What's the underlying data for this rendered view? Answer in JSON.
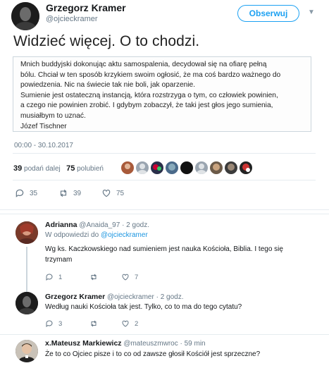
{
  "tweet": {
    "author": {
      "name": "Grzegorz Kramer",
      "handle": "@ojcieckramer"
    },
    "follow_label": "Obserwuj",
    "text": "Widzieć więcej. O to chodzi.",
    "quote_lines": [
      "Mnich buddyjski dokonując aktu samospalenia, decydował się na ofiarę pełną",
      "bólu. Chciał w ten sposób krzykiem swoim ogłosić, że ma coś bardzo ważnego do",
      "powiedzenia. Nic na świecie tak nie boli, jak oparzenie.",
      "Sumienie jest ostateczną instancją, która rozstrzyga o tym, co człowiek powinien,",
      "a czego nie powinien zrobić. I gdybym zobaczył, że taki jest głos jego sumienia,",
      "musiałbym to uznać.",
      "Józef Tischner"
    ],
    "timestamp": "00:00 - 30.10.2017",
    "retweets_count": "39",
    "retweets_label": "podań dalej",
    "likes_count": "75",
    "likes_label": "polubień",
    "actions": {
      "replies": "35",
      "retweets": "39",
      "likes": "75"
    }
  },
  "replies": [
    {
      "name": "Adrianna",
      "handle": "@Anaida_97",
      "time": "· 2 godz.",
      "reply_prefix": "W odpowiedzi do",
      "reply_to": "@ojcieckramer",
      "text_lines": [
        "Wg ks. Kaczkowskiego nad sumieniem jest nauka Kościoła, Biblia. I tego się",
        "trzymam"
      ],
      "actions": {
        "replies": "1",
        "retweets": "",
        "likes": "7"
      }
    },
    {
      "name": "Grzegorz Kramer",
      "handle": "@ojcieckramer",
      "time": "· 2 godz.",
      "text_lines": [
        "Według nauki Kościoła tak jest. Tylko, co to ma do tego cytatu?"
      ],
      "actions": {
        "replies": "3",
        "retweets": "",
        "likes": "2"
      }
    },
    {
      "name": "x.Mateusz Markiewicz",
      "handle": "@mateuszmwroc",
      "time": "· 59 min",
      "text_lines": [
        "Że to co Ojciec pisze i to co od zawsze głosił Kościół jest sprzeczne?"
      ],
      "actions": {
        "replies": "",
        "retweets": "",
        "likes": ""
      }
    }
  ],
  "colors": {
    "accent": "#1da1f2",
    "muted": "#657786",
    "border": "#e6ecf0"
  }
}
